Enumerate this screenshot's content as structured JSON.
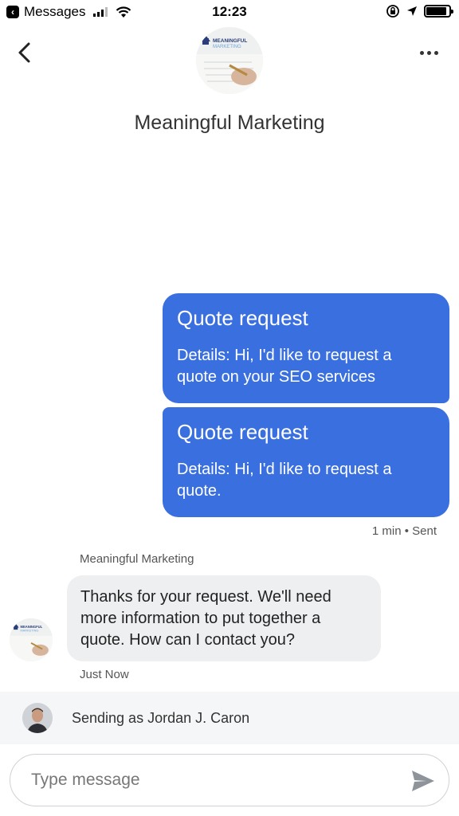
{
  "status_bar": {
    "back_app": "Messages",
    "time": "12:23",
    "battery_level": 0.9
  },
  "header": {
    "contact_name": "Meaningful Marketing",
    "avatar_logo": {
      "brand": "MEANINGFUL",
      "brand2": "MARKETING"
    }
  },
  "messages": {
    "outgoing": [
      {
        "title": "Quote request",
        "details": "Details: Hi, I'd like to request a quote on your SEO services"
      },
      {
        "title": "Quote request",
        "details": "Details: Hi, I'd like to request a quote."
      }
    ],
    "outgoing_status": "1 min • Sent",
    "incoming": {
      "sender": "Meaningful Marketing",
      "text": "Thanks for your request. We'll need more information to put together a quote. How can I contact you?",
      "time": "Just Now"
    }
  },
  "sending_as": "Sending as Jordan J. Caron",
  "composer": {
    "placeholder": "Type message",
    "value": ""
  },
  "colors": {
    "outgoing_bubble": "#3a6fe0",
    "incoming_bubble": "#eeeff1",
    "send_icon": "#8f949b"
  },
  "icons": [
    "back-chevron-icon",
    "more-icon",
    "send-icon",
    "wifi-icon",
    "location-icon",
    "orientation-lock-icon",
    "battery-icon"
  ]
}
